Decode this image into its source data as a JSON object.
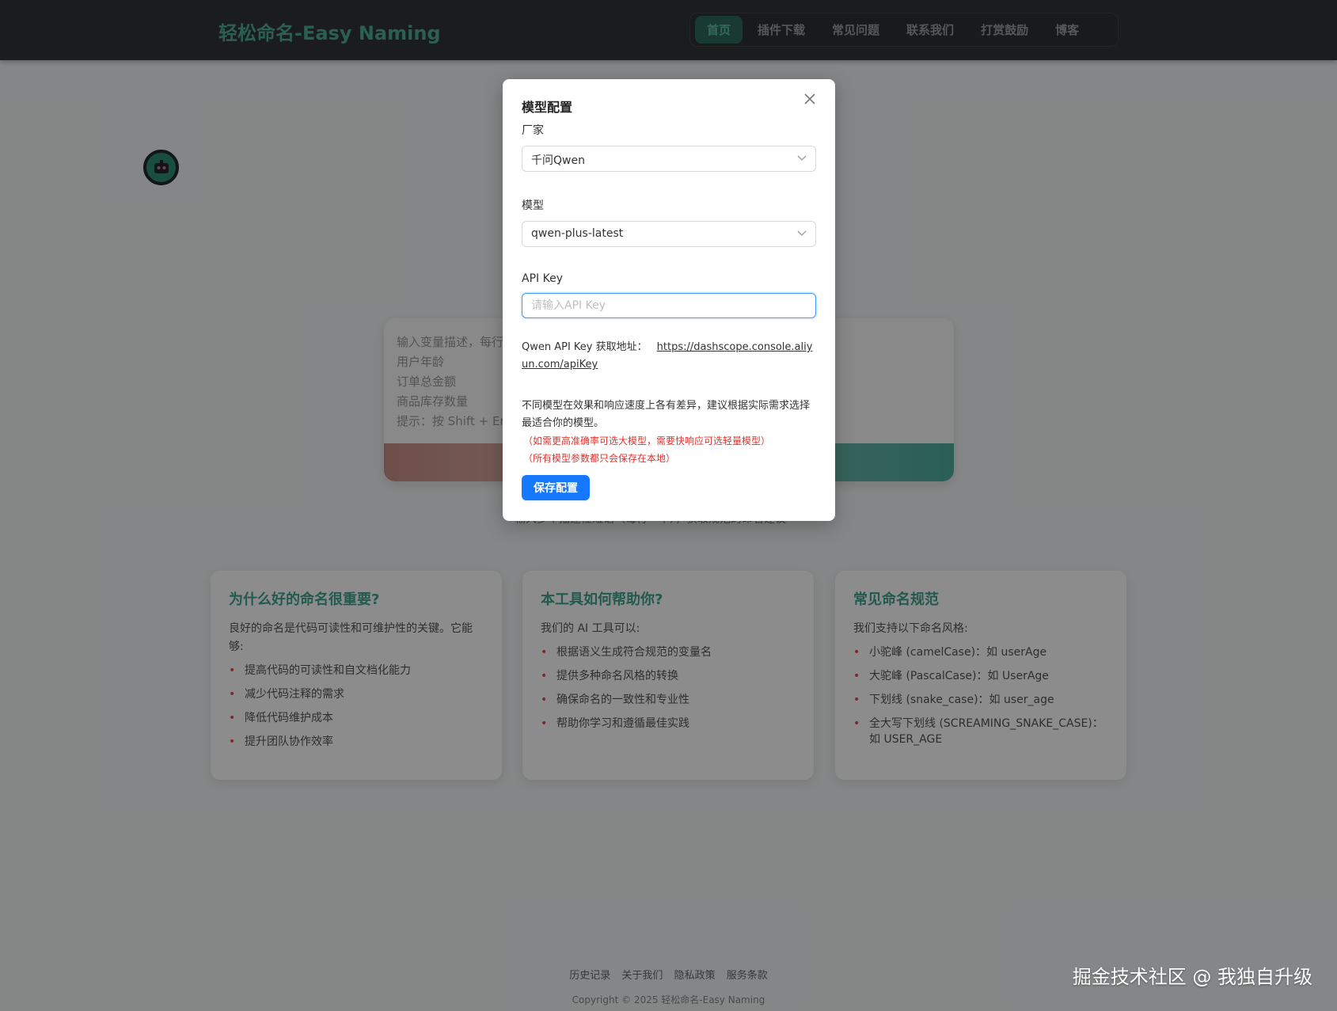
{
  "header": {
    "brand": "轻松命名-Easy Naming",
    "nav": [
      "首页",
      "插件下载",
      "常见问题",
      "联系我们",
      "打赏鼓励",
      "博客"
    ]
  },
  "editor": {
    "placeholder_lines": "输入变量描述，每行\n用户年龄\n订单总金额\n商品库存数量\n提示：按 Shift + En"
  },
  "under_editor_text": "输入多个描述性短语（每行一个），获取规范的命名建议",
  "cards": [
    {
      "title": "为什么好的命名很重要?",
      "intro": "良好的命名是代码可读性和可维护性的关键。它能够:",
      "items": [
        "提高代码的可读性和自文档化能力",
        "减少代码注释的需求",
        "降低代码维护成本",
        "提升团队协作效率"
      ]
    },
    {
      "title": "本工具如何帮助你?",
      "intro": "我们的 AI 工具可以:",
      "items": [
        "根据语义生成符合规范的变量名",
        "提供多种命名风格的转换",
        "确保命名的一致性和专业性",
        "帮助你学习和遵循最佳实践"
      ]
    },
    {
      "title": "常见命名规范",
      "intro": "我们支持以下命名风格:",
      "items": [
        "小驼峰 (camelCase)：如 userAge",
        "大驼峰 (PascalCase)：如 UserAge",
        "下划线 (snake_case)：如 user_age",
        "全大写下划线 (SCREAMING_SNAKE_CASE)：如 USER_AGE"
      ]
    }
  ],
  "footer": {
    "links": [
      "历史记录",
      "关于我们",
      "隐私政策",
      "服务条款"
    ],
    "copyright": "Copyright © 2025 轻松命名-Easy Naming"
  },
  "watermark": "掘金技术社区 @ 我独自升级",
  "modal": {
    "title": "模型配置",
    "vendor_label": "厂家",
    "vendor_value": "千问Qwen",
    "model_label": "模型",
    "model_value": "qwen-plus-latest",
    "apikey_label": "API Key",
    "apikey_placeholder": "请输入API Key",
    "apikey_link_label": "Qwen API Key 获取地址：",
    "apikey_link": "https://dashscope.console.aliyun.com/apiKey",
    "desc": "不同模型在效果和响应速度上各有差异，建议根据实际需求选择最适合你的模型。",
    "note1": "（如需更高准确率可选大模型，需要快响应可选轻量模型）",
    "note2": "（所有模型参数都只会保存在本地）",
    "save_label": "保存配置"
  }
}
